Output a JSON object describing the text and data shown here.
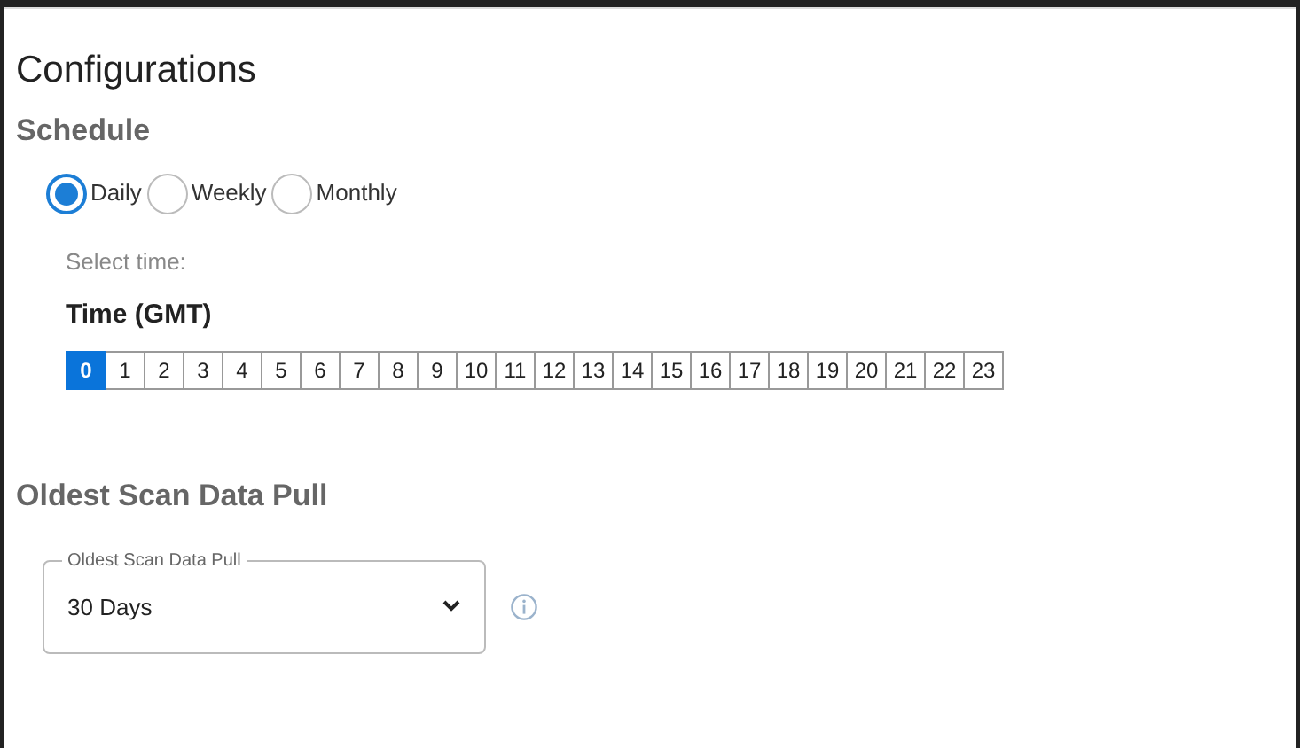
{
  "title": "Configurations",
  "schedule": {
    "heading": "Schedule",
    "options": [
      {
        "label": "Daily",
        "selected": true
      },
      {
        "label": "Weekly",
        "selected": false
      },
      {
        "label": "Monthly",
        "selected": false
      }
    ],
    "hint": "Select time:",
    "time_label": "Time (GMT)",
    "hours": [
      {
        "label": "0",
        "selected": true
      },
      {
        "label": "1",
        "selected": false
      },
      {
        "label": "2",
        "selected": false
      },
      {
        "label": "3",
        "selected": false
      },
      {
        "label": "4",
        "selected": false
      },
      {
        "label": "5",
        "selected": false
      },
      {
        "label": "6",
        "selected": false
      },
      {
        "label": "7",
        "selected": false
      },
      {
        "label": "8",
        "selected": false
      },
      {
        "label": "9",
        "selected": false
      },
      {
        "label": "10",
        "selected": false
      },
      {
        "label": "11",
        "selected": false
      },
      {
        "label": "12",
        "selected": false
      },
      {
        "label": "13",
        "selected": false
      },
      {
        "label": "14",
        "selected": false
      },
      {
        "label": "15",
        "selected": false
      },
      {
        "label": "16",
        "selected": false
      },
      {
        "label": "17",
        "selected": false
      },
      {
        "label": "18",
        "selected": false
      },
      {
        "label": "19",
        "selected": false
      },
      {
        "label": "20",
        "selected": false
      },
      {
        "label": "21",
        "selected": false
      },
      {
        "label": "22",
        "selected": false
      },
      {
        "label": "23",
        "selected": false
      }
    ]
  },
  "oldest": {
    "heading": "Oldest Scan Data Pull",
    "field_label": "Oldest Scan Data Pull",
    "value": "30 Days"
  }
}
